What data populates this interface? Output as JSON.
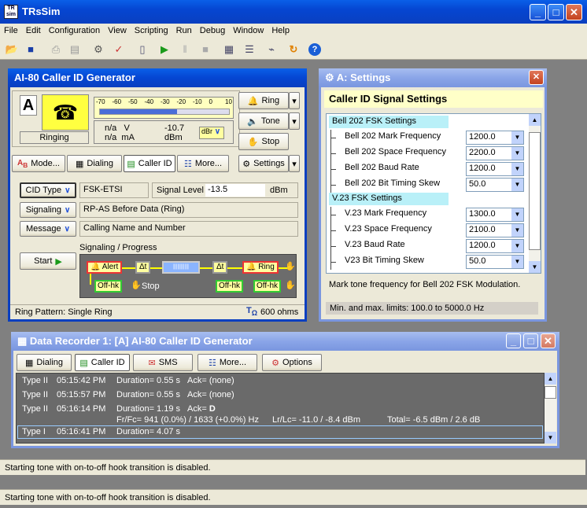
{
  "app": {
    "title": "TRsSim",
    "icon_text": "TR\nsim"
  },
  "menu": [
    "File",
    "Edit",
    "Configuration",
    "View",
    "Scripting",
    "Run",
    "Debug",
    "Window",
    "Help"
  ],
  "generator": {
    "title": "AI-80  Caller ID Generator",
    "channel": "A",
    "state": "Ringing",
    "meter_ticks": [
      "-70",
      "-60",
      "-50",
      "-40",
      "-30",
      "-20",
      "-10",
      "0",
      "10"
    ],
    "voltage": "n/a   V",
    "current": "n/a  mA",
    "level_value": "-10.7",
    "level_unit": "dBm",
    "level_unit_sel": "dBr",
    "ring_label": "Ring",
    "tone_label": "Tone",
    "stop_label": "Stop",
    "tabs": [
      "Mode...",
      "Dialing",
      "Caller ID",
      "More...",
      "Settings"
    ],
    "cid_type_btn": "CID Type",
    "cid_type_value": "FSK-ETSI",
    "signal_level_label": "Signal Level",
    "signal_level_value": "-13.5",
    "signal_level_unit": "dBm",
    "signaling_btn": "Signaling",
    "signaling_value": "RP-AS Before Data (Ring)",
    "message_btn": "Message",
    "message_value": "Calling Name and Number",
    "start_btn": "Start",
    "progress_title": "Signaling / Progress",
    "progress": {
      "alert": "Alert",
      "dt1": "Δt",
      "dt2": "Δt",
      "ring": "Ring",
      "offhk1": "Off-hk",
      "stop": "Stop",
      "offhk2": "Off-hk",
      "offhk3": "Off-hk"
    },
    "ring_pattern": "Ring Pattern:  Single Ring",
    "impedance": "600 ohms"
  },
  "settings": {
    "title": "A:  Settings",
    "heading": "Caller ID Signal Settings",
    "groups": [
      {
        "name": "Bell 202 FSK Settings",
        "rows": [
          {
            "label": "Bell 202 Mark Frequency",
            "value": "1200.0"
          },
          {
            "label": "Bell 202 Space Frequency",
            "value": "2200.0"
          },
          {
            "label": "Bell 202 Baud Rate",
            "value": "1200.0"
          },
          {
            "label": "Bell 202 Bit Timing Skew",
            "value": "50.0"
          }
        ]
      },
      {
        "name": "V.23 FSK Settings",
        "rows": [
          {
            "label": "V.23 Mark Frequency",
            "value": "1300.0"
          },
          {
            "label": "V.23 Space Frequency",
            "value": "2100.0"
          },
          {
            "label": "V.23 Baud Rate",
            "value": "1200.0"
          },
          {
            "label": "V23 Bit Timing Skew",
            "value": "50.0"
          }
        ]
      }
    ],
    "description": "Mark tone frequency for Bell 202 FSK Modulation.",
    "limits": "Min. and max. limits: 100.0 to 5000.0 Hz"
  },
  "recorder": {
    "title": "Data Recorder 1:  [A] AI-80  Caller ID Generator",
    "tabs": [
      "Dialing",
      "Caller ID",
      "SMS",
      "More...",
      "Options"
    ],
    "log": [
      {
        "type": "Type II",
        "time": "05:15:42 PM",
        "dur": "Duration= 0.55 s",
        "ack": "Ack= (none)"
      },
      {
        "type": "Type II",
        "time": "05:15:57 PM",
        "dur": "Duration= 0.55 s",
        "ack": "Ack= (none)"
      },
      {
        "type": "Type II",
        "time": "05:16:14 PM",
        "dur": "Duration= 1.19 s",
        "ack": "Ack= ",
        "ack_bold": "D",
        "detail": "Fr/Fc= 941 (0.0%) / 1633 (+0.0%) Hz",
        "lrlc": "Lr/Lc= -11.0 / -8.4 dBm",
        "total": "Total= -6.5 dBm / 2.6 dB"
      },
      {
        "type": "Type I",
        "time": "05:16:41 PM",
        "dur": "Duration= 4.07 s"
      }
    ]
  },
  "status_inner": "Starting tone with on-to-off hook transition is disabled.",
  "status_outer": "Starting tone with on-to-off hook transition is disabled."
}
